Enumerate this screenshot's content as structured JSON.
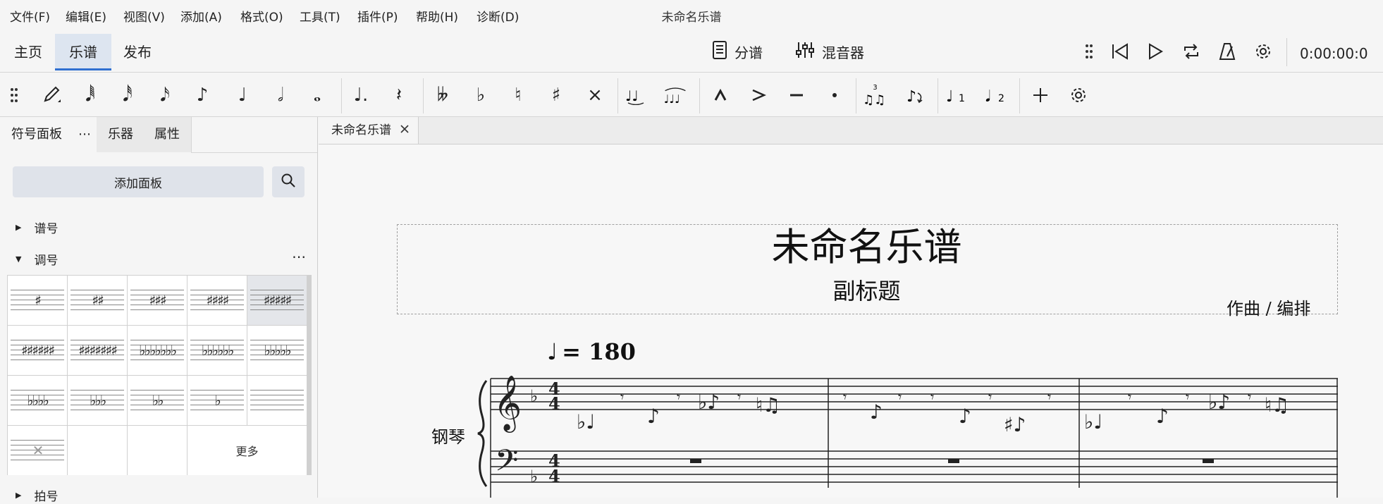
{
  "app_title": "未命名乐谱",
  "menu": [
    "文件(F)",
    "编辑(E)",
    "视图(V)",
    "添加(A)",
    "格式(O)",
    "工具(T)",
    "插件(P)",
    "帮助(H)",
    "诊断(D)"
  ],
  "workspace_tabs": [
    "主页",
    "乐谱",
    "发布"
  ],
  "active_workspace": "乐谱",
  "center_items": {
    "parts": "分谱",
    "mixer": "混音器"
  },
  "playback": {
    "time": "0:00:00:0"
  },
  "toolbar_icons": [
    "drag-handle-icon",
    "pencil-input-icon",
    "64th-note-icon",
    "32nd-note-icon",
    "16th-note-icon",
    "8th-note-icon",
    "quarter-note-icon",
    "half-note-icon",
    "whole-note-icon",
    "augmentation-dot-icon",
    "rest-icon",
    "double-flat-icon",
    "flat-icon",
    "natural-icon",
    "sharp-icon",
    "double-sharp-icon",
    "tie-icon",
    "slur-icon",
    "marcato-icon",
    "accent-icon",
    "tenuto-icon",
    "staccato-icon",
    "tuplet-icon",
    "flip-direction-icon",
    "voice-1-icon",
    "voice-2-icon",
    "add-icon",
    "settings-icon"
  ],
  "panel": {
    "tabs": [
      "符号面板",
      "乐器",
      "属性"
    ],
    "add_palette": "添加面板",
    "sections": {
      "clefs": "谱号",
      "key_signatures": "调号",
      "time_signatures": "拍号"
    },
    "more": "更多",
    "key_cells": [
      "♯",
      "♯♯",
      "♯♯♯",
      "♯♯♯♯",
      "♯♯♯♯♯",
      "♯♯♯♯♯♯",
      "♯♯♯♯♯♯♯",
      "♭♭♭♭♭♭♭",
      "♭♭♭♭♭♭",
      "♭♭♭♭♭",
      "♭♭♭♭",
      "♭♭♭",
      "♭♭",
      "♭",
      "",
      "✕",
      "",
      "",
      "更多"
    ]
  },
  "document_tab": {
    "label": "未命名乐谱"
  },
  "score": {
    "title": "未命名乐谱",
    "subtitle": "副标题",
    "composer": "作曲 / 编排",
    "tempo": "= 180",
    "instrument": "钢琴",
    "time_signature": "4/4",
    "key": "F major (1 flat)"
  },
  "colors": {
    "accent": "#2f6fd0",
    "active_tab_bg": "#dde5f0",
    "background": "#f5f5f5"
  }
}
